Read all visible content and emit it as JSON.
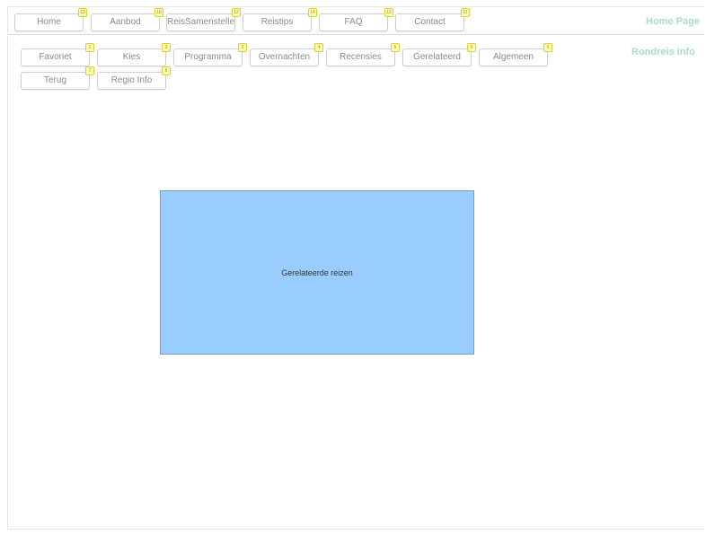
{
  "top_nav": {
    "items": [
      {
        "label": "Home",
        "badge": "13"
      },
      {
        "label": "Aanbod",
        "badge": "10"
      },
      {
        "label": "ReisSamenstelle",
        "badge": "12"
      },
      {
        "label": "Reistips",
        "badge": "14"
      },
      {
        "label": "FAQ",
        "badge": "12"
      },
      {
        "label": "Contact",
        "badge": "11"
      }
    ],
    "page_label": "Home Page"
  },
  "sub_nav": {
    "items": [
      {
        "label": "Favoriet",
        "badge": "1"
      },
      {
        "label": "Kies",
        "badge": "2"
      },
      {
        "label": "Programma",
        "badge": "3"
      },
      {
        "label": "Overnachten",
        "badge": "4"
      },
      {
        "label": "Recensies",
        "badge": "5"
      },
      {
        "label": "Gerelateerd",
        "badge": "6"
      },
      {
        "label": "Algemeen",
        "badge": "6"
      },
      {
        "label": "Terug",
        "badge": "7"
      },
      {
        "label": "Regio Info",
        "badge": "8"
      }
    ],
    "section_label": "Rondreis Info"
  },
  "content": {
    "panel_text": "Gerelateerde reizen"
  },
  "colors": {
    "panel_fill": "#99ccff",
    "badge_fill": "#fffbb0",
    "label_color": "#a8dcc8"
  }
}
